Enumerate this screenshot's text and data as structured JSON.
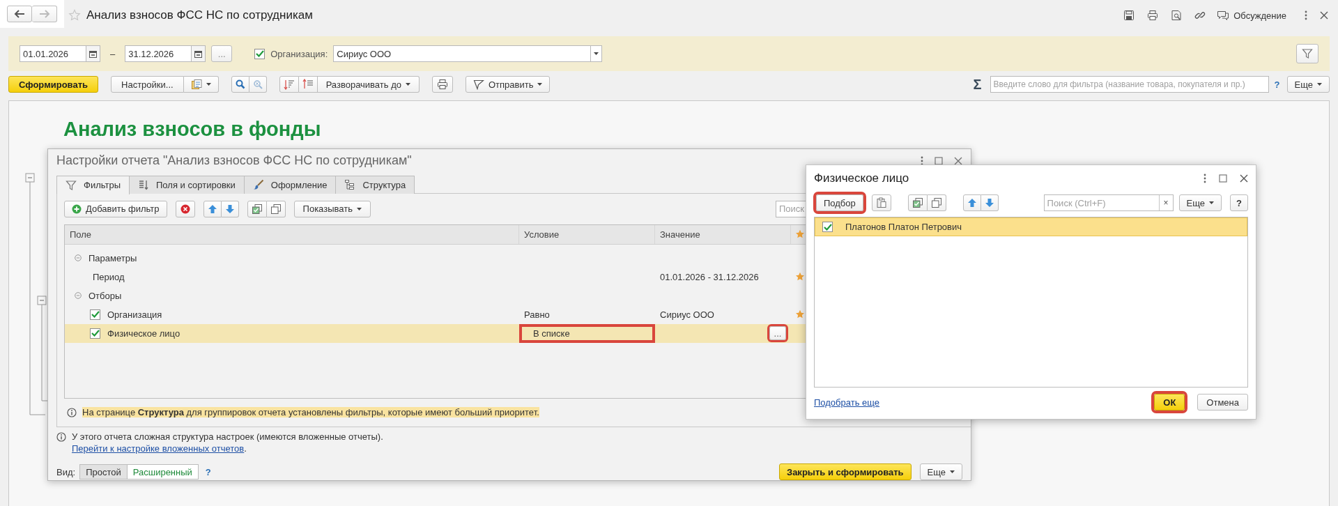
{
  "header": {
    "title": "Анализ взносов ФСС НС по сотрудникам",
    "discussion": "Обсуждение"
  },
  "period": {
    "from": "01.01.2026",
    "dash": "–",
    "to": "31.12.2026",
    "more": "..."
  },
  "organization": {
    "checked": true,
    "label": "Организация:",
    "value": "Сириус ООО"
  },
  "toolbar": {
    "generate": "Сформировать",
    "settings": "Настройки...",
    "expand": "Разворачивать до",
    "send": "Отправить",
    "sum": "Σ",
    "filter_placeholder": "Введите слово для фильтра (название товара, покупателя и пр.)",
    "help": "?",
    "more": "Еще"
  },
  "report": {
    "title": "Анализ взносов в фонды"
  },
  "settings_dialog": {
    "title": "Настройки отчета \"Анализ взносов ФСС НС по сотрудникам\"",
    "tabs": [
      {
        "label": "Фильтры",
        "selected": true
      },
      {
        "label": "Поля и сортировки",
        "selected": false
      },
      {
        "label": "Оформление",
        "selected": false
      },
      {
        "label": "Структура",
        "selected": false
      }
    ],
    "add_filter": "Добавить фильтр",
    "show": "Показывать",
    "search_placeholder": "Поиск",
    "columns": [
      "Поле",
      "Условие",
      "Значение"
    ],
    "rows": [
      {
        "kind": "group",
        "label": "Параметры",
        "expanded": true,
        "selected": false,
        "children": [
          {
            "kind": "param",
            "label": "Период",
            "value": "01.01.2026 - 31.12.2026",
            "quick": true,
            "selected": false
          }
        ]
      },
      {
        "kind": "group",
        "label": "Отборы",
        "expanded": true,
        "selected": false,
        "children": [
          {
            "kind": "filter",
            "label": "Организация",
            "checked": true,
            "condition": "Равно",
            "value": "Сириус ООО",
            "quick": true,
            "selected": false
          },
          {
            "kind": "filter",
            "label": "Физическое лицо",
            "checked": true,
            "condition": "В списке",
            "condition_marked": true,
            "value_button": "...",
            "value_button_marked": true,
            "quick": false,
            "selected": true
          }
        ]
      }
    ],
    "notice": "На странице **Структура** для группировок отчета установлены фильтры, которые имеют больший приоритет.",
    "info": "У этого отчета сложная структура настроек (имеются вложенные отчеты).",
    "info_link": "Перейти к настройке вложенных отчетов",
    "info_link_end": ".",
    "view_label": "Вид:",
    "views": [
      {
        "label": "Простой",
        "selected": false
      },
      {
        "label": "Расширенный",
        "selected": true
      }
    ],
    "help": "?",
    "close_generate": "Закрыть и сформировать",
    "more": "Еще"
  },
  "picker_dialog": {
    "title": "Физическое лицо",
    "pick": {
      "label": "Подбор",
      "marked": true
    },
    "search_placeholder": "Поиск (Ctrl+F)",
    "clear": "×",
    "more": "Еще",
    "help": "?",
    "items": [
      {
        "label": "Платонов Платон Петрович",
        "checked": true,
        "selected": true
      }
    ],
    "pick_more": "Подобрать еще",
    "ok": {
      "label": "ОК",
      "marked": true
    },
    "cancel": "Отмена"
  }
}
